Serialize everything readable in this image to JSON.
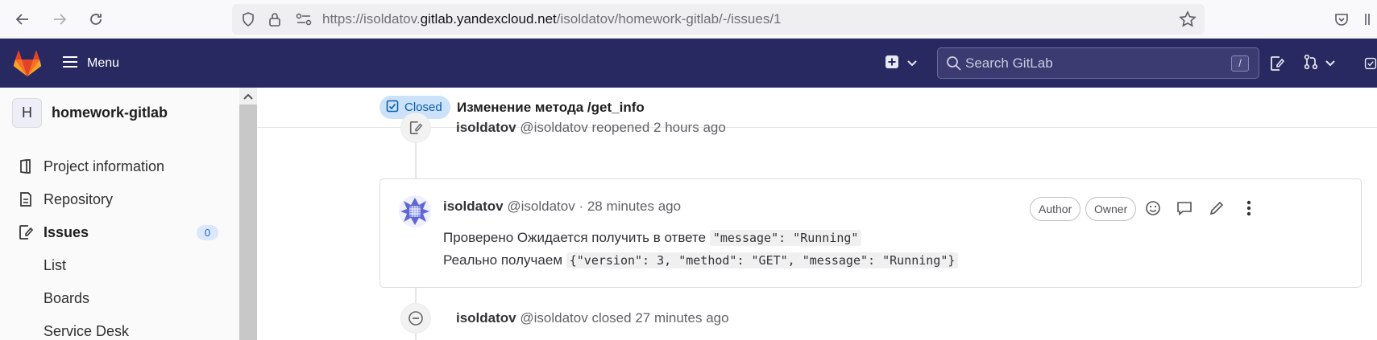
{
  "browser": {
    "url_prefix": "https://isoldatov.",
    "url_domain": "gitlab.yandexcloud.net",
    "url_path": "/isoldatov/homework-gitlab/-/issues/1"
  },
  "header": {
    "menu_label": "Menu",
    "search_placeholder": "Search GitLab",
    "search_shortcut": "/"
  },
  "sidebar": {
    "project_initial": "H",
    "project_name": "homework-gitlab",
    "items": [
      {
        "label": "Project information",
        "icon": "project-icon"
      },
      {
        "label": "Repository",
        "icon": "doc-icon"
      },
      {
        "label": "Issues",
        "icon": "issues-icon",
        "count": "0"
      },
      {
        "label": "List"
      },
      {
        "label": "Boards"
      },
      {
        "label": "Service Desk"
      }
    ]
  },
  "issue": {
    "status": "Closed",
    "title": "Изменение метода /get_info"
  },
  "timeline": {
    "reopened": {
      "author": "isoldatov",
      "handle": "@isoldatov",
      "action": "reopened 2 hours ago"
    },
    "note": {
      "author": "isoldatov",
      "handle": "@isoldatov",
      "time": "· 28 minutes ago",
      "badges": [
        "Author",
        "Owner"
      ],
      "line1_text": "Проверено Ожидается получить в ответе",
      "line1_code": "\"message\": \"Running\"",
      "line2_text": "Реально получаем",
      "line2_code": "{\"version\": 3, \"method\": \"GET\", \"message\": \"Running\"}"
    },
    "closed": {
      "author": "isoldatov",
      "handle": "@isoldatov",
      "action": "closed 27 minutes ago"
    }
  },
  "colors": {
    "header_bg": "#292961",
    "status_bg": "#cbe2f9",
    "status_fg": "#0b5cad",
    "logo": "#e24329"
  }
}
